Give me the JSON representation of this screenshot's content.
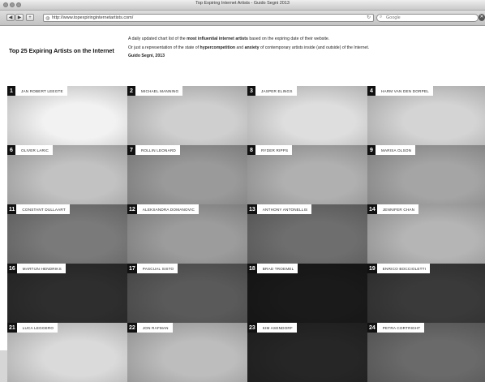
{
  "window": {
    "title": "Top Expiring Internet Artists - Guido Segni 2013"
  },
  "toolbar": {
    "back_icon": "◀",
    "forward_icon": "▶",
    "add_icon": "+",
    "url": "http://www.topexpiringinternetartists.com/",
    "search_placeholder": "Google"
  },
  "page": {
    "site_title": "Top 25 Expiring Artists on the Internet",
    "desc_line1_pre": "A daily updated chart list of the ",
    "desc_line1_b1": "most influential internet artists",
    "desc_line1_post": " based on the expiring date of their website.",
    "desc_line2_pre": "Or just a representation of the state of ",
    "desc_line2_b1": "hypercompetition",
    "desc_line2_mid": " and ",
    "desc_line2_b2": "anxiety",
    "desc_line2_post": " of contemporary artists inside (and outside) of the Internet.",
    "author": "Guido Segni, 2013"
  },
  "artists": [
    {
      "num": "1",
      "name": "Jan Robert Leegte",
      "tone": "#f2f2f2"
    },
    {
      "num": "2",
      "name": "Michael Manning",
      "tone": "#cfcfcf"
    },
    {
      "num": "3",
      "name": "Jasper Elings",
      "tone": "#dedede"
    },
    {
      "num": "4",
      "name": "Harm van den Dorpel",
      "tone": "#d4d4d4"
    },
    {
      "num": "6",
      "name": "Oliver Laric",
      "tone": "#c2c2c2"
    },
    {
      "num": "7",
      "name": "Rollin Leonard",
      "tone": "#9a9a9a"
    },
    {
      "num": "8",
      "name": "Ryder Ripps",
      "tone": "#b0b0b0"
    },
    {
      "num": "9",
      "name": "Marisa Olson",
      "tone": "#a5a5a5"
    },
    {
      "num": "11",
      "name": "Constant Dullaart",
      "tone": "#7a7a7a"
    },
    {
      "num": "12",
      "name": "Aleksandra Domanovic",
      "tone": "#9c9c9c"
    },
    {
      "num": "13",
      "name": "Anthony Antonellis",
      "tone": "#6e6e6e"
    },
    {
      "num": "14",
      "name": "Jennifer Chan",
      "tone": "#b5b5b5"
    },
    {
      "num": "16",
      "name": "Martijn Hendriks",
      "tone": "#2e2e2e"
    },
    {
      "num": "17",
      "name": "Pascual Sisto",
      "tone": "#5a5a5a"
    },
    {
      "num": "18",
      "name": "Brad Troemel",
      "tone": "#1a1a1a"
    },
    {
      "num": "19",
      "name": "Enrico Boccioletti",
      "tone": "#3a3a3a"
    },
    {
      "num": "21",
      "name": "Luca Leggero",
      "tone": "#dadada"
    },
    {
      "num": "22",
      "name": "Jon Rafman",
      "tone": "#bdbdbd"
    },
    {
      "num": "23",
      "name": "Kim Asendorf",
      "tone": "#262626"
    },
    {
      "num": "24",
      "name": "Petra Cortright",
      "tone": "#6a6a6a"
    }
  ]
}
